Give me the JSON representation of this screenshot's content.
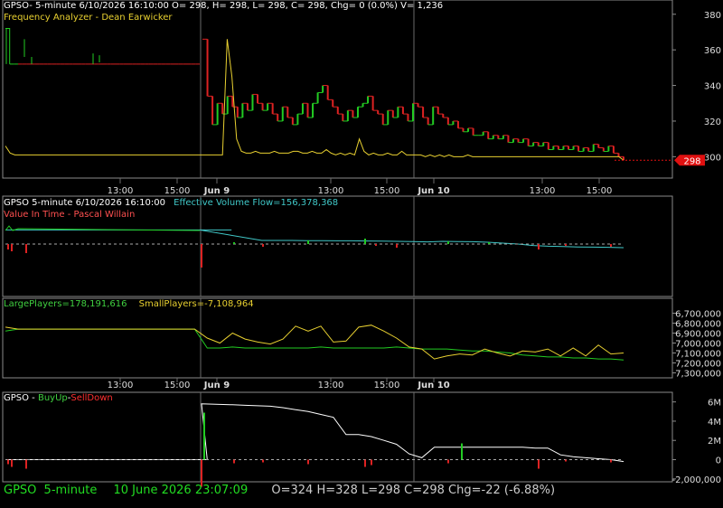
{
  "panels": {
    "price": {
      "header": "GPSO- 5-minute 6/10/2026 16:10:00 O= 298, H= 298, L= 298, C= 298, Chg= 0 (0.0%) V= 1,236",
      "indicator": "Frequency Analyzer - Dean Earwicker",
      "price_tag": "298"
    },
    "evf": {
      "header_prefix": "GPSO 5-minute  6/10/2026 16:10:00",
      "header_value": "Effective Volume Flow=156,378,368",
      "indicator": "Value In Time - Pascal Willain"
    },
    "players": {
      "large": "LargePlayers=178,191,616",
      "small": "SmallPlayers=-7,108,964"
    },
    "buyup": {
      "prefix": "GPSO - ",
      "buy": "BuyUp",
      "dash": "-",
      "sell": "SellDown"
    }
  },
  "x_axis": {
    "row1": [
      "13:00",
      "15:00",
      "Jun 9",
      "13:00",
      "15:00",
      "Jun 10",
      "13:00",
      "15:00"
    ],
    "row2": [
      "13:00",
      "15:00",
      "Jun 9",
      "13:00",
      "15:00",
      "Jun 10"
    ]
  },
  "status_bar": {
    "symbol": "GPSO",
    "interval": "5-minute",
    "datetime": "10 June 2026 23:07:09",
    "ohlc": "O=324  H=328  L=298  C=298  Chg=-22 (-6.88%)"
  },
  "colors": {
    "up": "#22cc22",
    "down": "#dd2222",
    "yellow": "#e8d030",
    "cyan": "#40c8c8",
    "white": "#ffffff",
    "grid": "#3c3c3c",
    "axis_text": "#dddddd"
  },
  "chart_data": [
    {
      "type": "line",
      "name": "price",
      "ylim": [
        288,
        388
      ],
      "yticks": [
        "380",
        "360",
        "340",
        "320",
        "300"
      ],
      "ytick_values": [
        380,
        360,
        340,
        320,
        300
      ],
      "close_day1": [
        372,
        352,
        352,
        352,
        352,
        352,
        352,
        352,
        352,
        352,
        352,
        352,
        352,
        352,
        352,
        352,
        352,
        352,
        352,
        352,
        352,
        352,
        352,
        352,
        352,
        352,
        352,
        352,
        352,
        352,
        352,
        352,
        352,
        352,
        352,
        352,
        352,
        352,
        352,
        352,
        352,
        352,
        352,
        352,
        352,
        352,
        352
      ],
      "close_days23": [
        366,
        334,
        318,
        330,
        324,
        334,
        328,
        322,
        330,
        326,
        335,
        330,
        326,
        330,
        324,
        320,
        328,
        322,
        318,
        324,
        330,
        322,
        330,
        336,
        340,
        332,
        328,
        324,
        320,
        326,
        322,
        328,
        330,
        334,
        326,
        324,
        318,
        326,
        322,
        328,
        324,
        320,
        330,
        328,
        322,
        318,
        328,
        324,
        322,
        318,
        320,
        316,
        314,
        316,
        312,
        312,
        314,
        310,
        312,
        310,
        312,
        308,
        310,
        308,
        310,
        306,
        308,
        306,
        308,
        304,
        306,
        304,
        306,
        304,
        306,
        303,
        305,
        303,
        307,
        305,
        303,
        306,
        302,
        300,
        298
      ],
      "indicator_freq": [
        306,
        302,
        301,
        301,
        301,
        301,
        301,
        301,
        301,
        301,
        301,
        301,
        301,
        301,
        301,
        301,
        301,
        301,
        301,
        301,
        301,
        301,
        301,
        301,
        301,
        301,
        301,
        301,
        301,
        301,
        301,
        301,
        301,
        301,
        301,
        301,
        301,
        301,
        301,
        301,
        301,
        301,
        301,
        301,
        301,
        301,
        301,
        366,
        345,
        310,
        303,
        302,
        302,
        303,
        302,
        302,
        302,
        303,
        302,
        302,
        302,
        303,
        303,
        302,
        302,
        303,
        302,
        302,
        304,
        302,
        301,
        302,
        301,
        302,
        301,
        310,
        303,
        301,
        302,
        301,
        301,
        302,
        301,
        301,
        303,
        301,
        301,
        301,
        301,
        300,
        301,
        300,
        301,
        300,
        301,
        300,
        300,
        300,
        301,
        300,
        300,
        300,
        300,
        300,
        300,
        300,
        300,
        300,
        300,
        300,
        300,
        300,
        300,
        300,
        300,
        300,
        300,
        300,
        300,
        300,
        300,
        300,
        300,
        300,
        300,
        300,
        300,
        300,
        300,
        300,
        300,
        298
      ]
    },
    {
      "type": "line",
      "name": "value in time",
      "series": [
        {
          "values": [
            0.78,
            0.78,
            0.78,
            0.78,
            0.78,
            0.78,
            0.78,
            0.78,
            0.78,
            0.78,
            0.78,
            0.78,
            0.78,
            0.78,
            0.78,
            0.78,
            0.78,
            0.2,
            0.2,
            0.2,
            0.19,
            0.19,
            0.18,
            0.18,
            0.17,
            0.16,
            0.15,
            0.14,
            0.12,
            0.15,
            0.14,
            0.13,
            0.1,
            0.05,
            0.0,
            -0.08,
            -0.12,
            -0.14,
            -0.16,
            -0.17,
            -0.18,
            -0.2
          ]
        },
        {
          "values": [
            0.28,
            0.28,
            0.28,
            0.28,
            0.28,
            0.28,
            0.28,
            0.28,
            0.28,
            0.28,
            0.28,
            0.28,
            0.28,
            0.28,
            0.28,
            0.28,
            0.28,
            0.28,
            0.28,
            0.28,
            0.28,
            0.28,
            0.28,
            0.28,
            0.28,
            0.28,
            0.28,
            0.28,
            0.28,
            0.28,
            0.28,
            0.28,
            0.28,
            0.28,
            0.28,
            0.28,
            0.28,
            0.28,
            0.28,
            0.28,
            0.28,
            0.28
          ]
        }
      ]
    },
    {
      "type": "line",
      "name": "players",
      "ylim": [
        -7350000,
        -6550000
      ],
      "yticks": [
        "6,700,000",
        "6,800,000",
        "6,900,000",
        "7,000,000",
        "7,100,000",
        "7,200,000",
        "7,300,000"
      ],
      "ytick_values": [
        -6700000,
        -6800000,
        -6900000,
        -7000000,
        -7100000,
        -7200000,
        -7300000
      ],
      "series": [
        {
          "name": "LargePlayers",
          "values": [
            -6880000,
            -6860000,
            -6860000,
            -6860000,
            -6860000,
            -6860000,
            -6860000,
            -6860000,
            -6860000,
            -6860000,
            -6860000,
            -6860000,
            -6860000,
            -6860000,
            -6860000,
            -6860000,
            -7050000,
            -7050000,
            -7040000,
            -7050000,
            -7050000,
            -7050000,
            -7050000,
            -7050000,
            -7050000,
            -7040000,
            -7050000,
            -7050000,
            -7050000,
            -7050000,
            -7050000,
            -7040000,
            -7050000,
            -7060000,
            -7060000,
            -7060000,
            -7070000,
            -7080000,
            -7080000,
            -7090000,
            -7100000,
            -7120000,
            -7130000,
            -7140000,
            -7140000,
            -7150000,
            -7150000,
            -7160000,
            -7160000,
            -7170000
          ]
        },
        {
          "name": "SmallPlayers",
          "values": [
            -6840000,
            -6860000,
            -6860000,
            -6860000,
            -6860000,
            -6860000,
            -6860000,
            -6860000,
            -6860000,
            -6860000,
            -6860000,
            -6860000,
            -6860000,
            -6860000,
            -6860000,
            -6860000,
            -6950000,
            -7000000,
            -6900000,
            -6960000,
            -6990000,
            -7010000,
            -6960000,
            -6830000,
            -6880000,
            -6830000,
            -6990000,
            -6980000,
            -6840000,
            -6820000,
            -6880000,
            -6950000,
            -7040000,
            -7060000,
            -7160000,
            -7130000,
            -7110000,
            -7120000,
            -7060000,
            -7100000,
            -7130000,
            -7080000,
            -7090000,
            -7060000,
            -7130000,
            -7050000,
            -7130000,
            -7020000,
            -7110000,
            -7100000
          ]
        }
      ]
    },
    {
      "type": "line",
      "name": "BuyUp-SellDown",
      "ylim": [
        -2300000,
        7000000
      ],
      "yticks": [
        "6M",
        "4M",
        "2M",
        "0",
        "-2,000,000"
      ],
      "ytick_values": [
        6000000,
        4000000,
        2000000,
        0,
        -2000000
      ],
      "series": [
        {
          "name": "BuyUp-SellDown",
          "values": [
            0,
            0,
            0,
            0,
            0,
            0,
            0,
            0,
            0,
            0,
            0,
            0,
            0,
            0,
            0,
            0,
            0,
            5800000,
            5700000,
            5650000,
            5600000,
            5550000,
            5400000,
            5200000,
            5000000,
            4700000,
            4400000,
            2600000,
            2600000,
            2400000,
            2000000,
            1600000,
            600000,
            200000,
            1300000,
            1300000,
            1300000,
            1300000,
            1300000,
            1300000,
            1300000,
            1300000,
            1200000,
            1200000,
            500000,
            300000,
            200000,
            100000,
            0,
            -200000
          ]
        }
      ]
    }
  ]
}
